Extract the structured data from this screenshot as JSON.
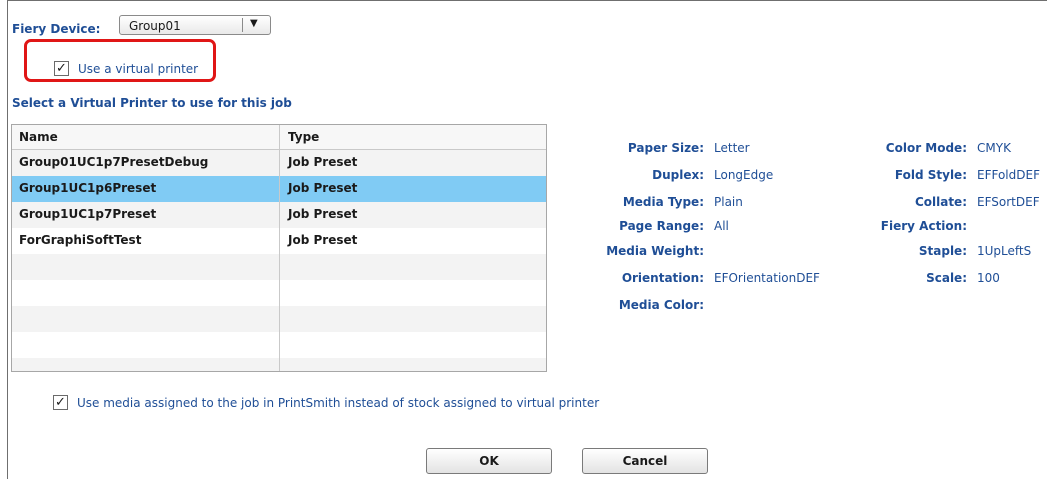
{
  "device": {
    "label": "Fiery Device:",
    "selected": "Group01",
    "arrow": "▼"
  },
  "virtual_printer_checkbox": {
    "label": "Use a virtual printer",
    "checked": true,
    "mark": "✓"
  },
  "section_title": "Select a Virtual Printer to use for this job",
  "table": {
    "columns": [
      "Name",
      "Type"
    ],
    "rows": [
      {
        "name": "Group01UC1p7PresetDebug",
        "type": "Job Preset"
      },
      {
        "name": "Group1UC1p6Preset",
        "type": "Job Preset",
        "selected": true
      },
      {
        "name": "Group1UC1p7Preset",
        "type": "Job Preset"
      },
      {
        "name": "ForGraphiSoftTest",
        "type": "Job Preset"
      }
    ]
  },
  "properties_left": [
    {
      "label": "Paper Size:",
      "value": "Letter"
    },
    {
      "label": "Duplex:",
      "value": "LongEdge"
    },
    {
      "label": "Media Type:",
      "value": "Plain"
    },
    {
      "label": "Page Range:",
      "value": "All"
    },
    {
      "label": "Media Weight:",
      "value": ""
    },
    {
      "label": "Orientation:",
      "value": "EFOrientationDEF"
    },
    {
      "label": "Media Color:",
      "value": ""
    }
  ],
  "properties_right": [
    {
      "label": "Color Mode:",
      "value": "CMYK"
    },
    {
      "label": "Fold Style:",
      "value": "EFFoldDEF"
    },
    {
      "label": "Collate:",
      "value": "EFSortDEF"
    },
    {
      "label": "Fiery Action:",
      "value": ""
    },
    {
      "label": "Staple:",
      "value": "1UpLeftS"
    },
    {
      "label": "Scale:",
      "value": "100"
    }
  ],
  "media_checkbox": {
    "label": "Use media assigned to the job in PrintSmith instead of stock assigned to  virtual printer",
    "checked": true,
    "mark": "✓"
  },
  "buttons": {
    "ok": "OK",
    "cancel": "Cancel"
  },
  "colors": {
    "accent": "#1f4e96",
    "selection": "#80cbf4",
    "highlight": "#e01616"
  }
}
